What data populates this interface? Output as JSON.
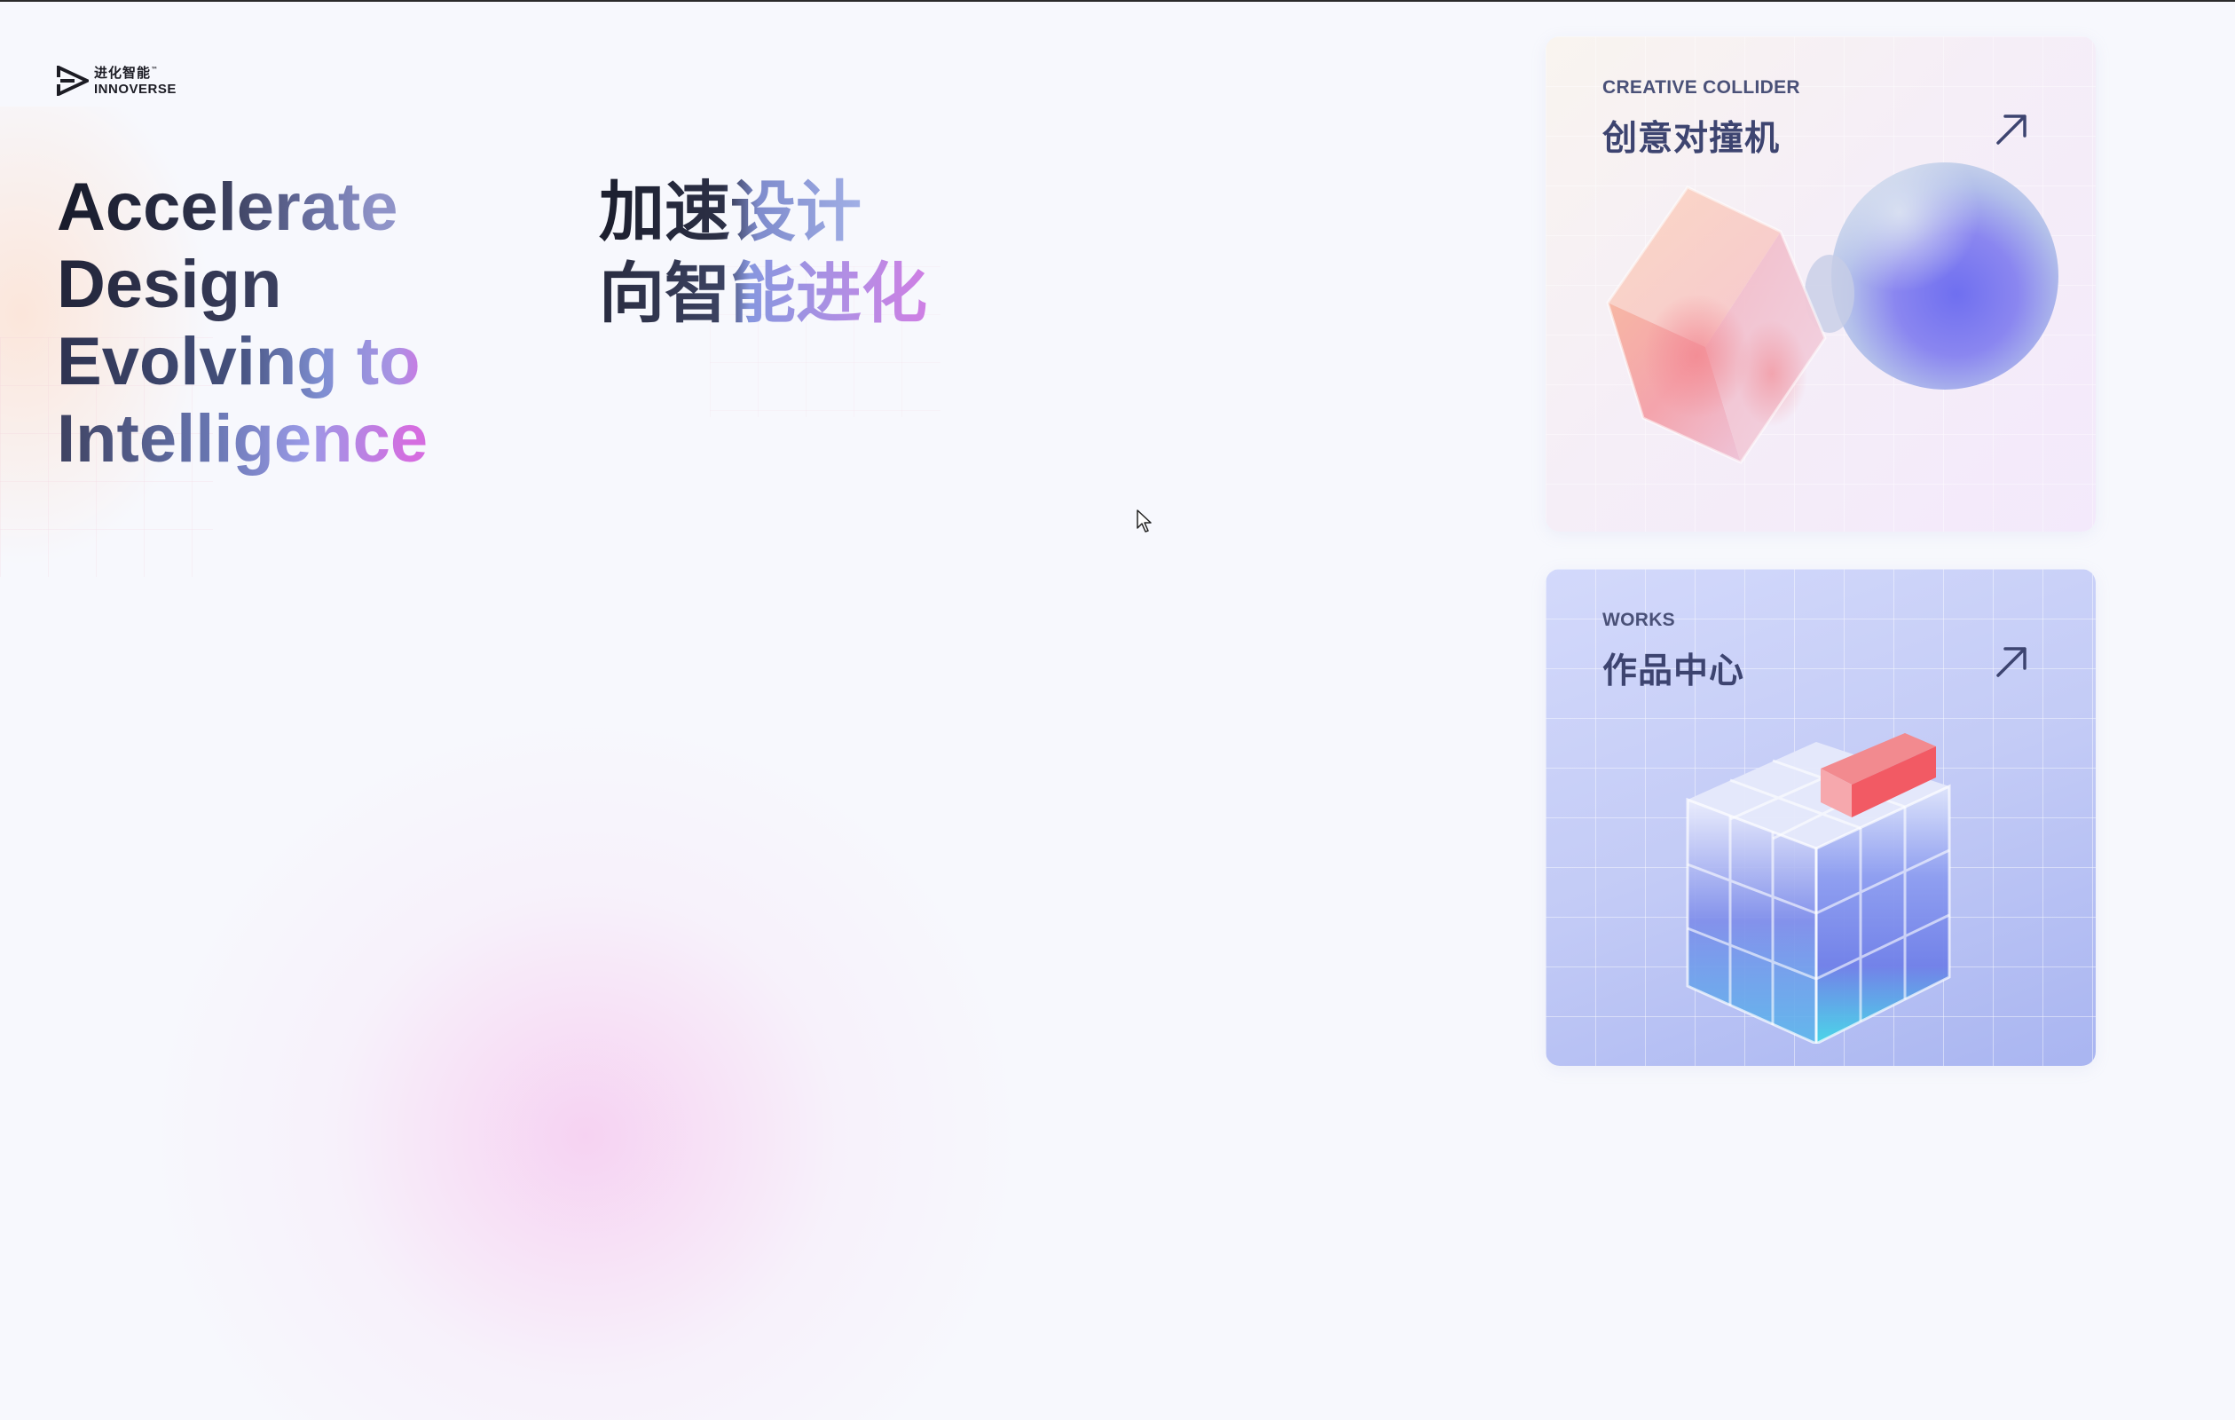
{
  "logo": {
    "name_cn": "进化智能",
    "trademark": "™",
    "name_en": "INNOVERSE"
  },
  "hero": {
    "headline_en": [
      "Accelerate",
      "Design",
      "Evolving to",
      "Intelligence"
    ],
    "headline_cn": [
      "加速设计",
      "向智能进化"
    ]
  },
  "cards": [
    {
      "tag": "CREATIVE COLLIDER",
      "title": "创意对撞机",
      "arrow_icon": "arrow-up-right-icon"
    },
    {
      "tag": "WORKS",
      "title": "作品中心",
      "arrow_icon": "arrow-up-right-icon"
    }
  ],
  "colors": {
    "background": "#f7f8fd",
    "text_dark": "#171a2a",
    "card_text": "#3d4470",
    "accent_purple": "#d56de0",
    "accent_blue": "#8797df"
  }
}
